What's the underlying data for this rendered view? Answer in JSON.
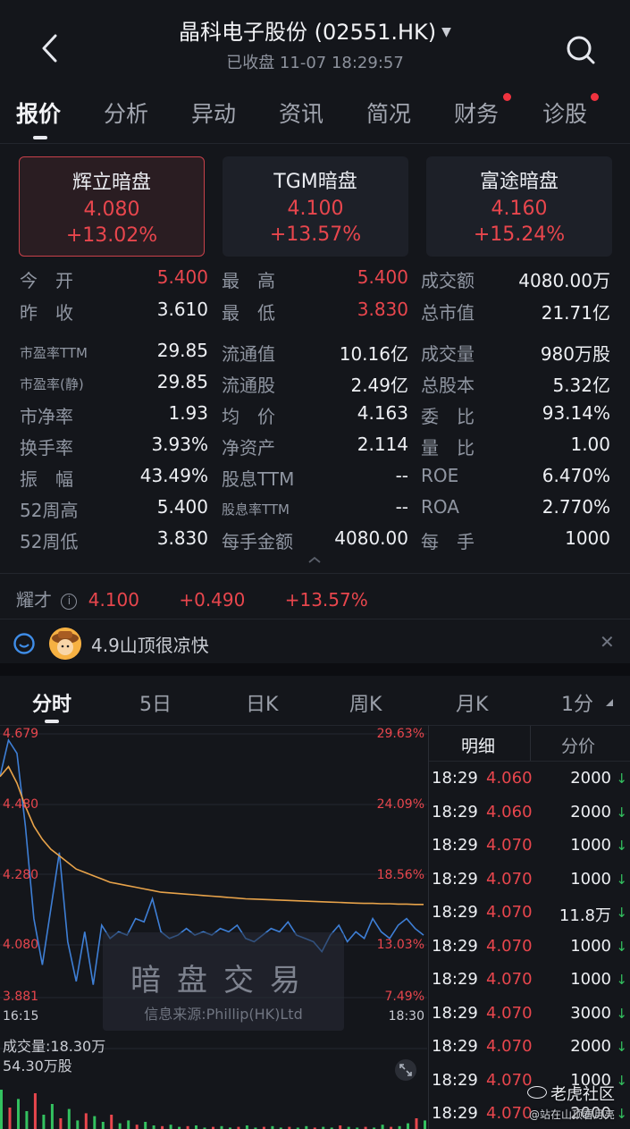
{
  "header": {
    "title": "晶科电子股份 (02551.HK)",
    "status_time": "已收盘 11-07 18:29:57"
  },
  "tabs": [
    {
      "label": "报价",
      "active": true,
      "dot": false
    },
    {
      "label": "分析",
      "active": false,
      "dot": false
    },
    {
      "label": "异动",
      "active": false,
      "dot": false
    },
    {
      "label": "资讯",
      "active": false,
      "dot": false
    },
    {
      "label": "简况",
      "active": false,
      "dot": false
    },
    {
      "label": "财务",
      "active": false,
      "dot": true
    },
    {
      "label": "诊股",
      "active": false,
      "dot": true
    }
  ],
  "dark_pools": [
    {
      "name": "辉立暗盘",
      "price": "4.080",
      "change": "+13.02%",
      "selected": true
    },
    {
      "name": "TGM暗盘",
      "price": "4.100",
      "change": "+13.57%",
      "selected": false
    },
    {
      "name": "富途暗盘",
      "price": "4.160",
      "change": "+15.24%",
      "selected": false
    }
  ],
  "stats": [
    [
      {
        "label": "今　开",
        "value": "5.400",
        "color": "red"
      },
      {
        "label": "最　高",
        "value": "5.400",
        "color": "red"
      },
      {
        "label": "成交额",
        "value": "4080.00万",
        "color": "white"
      }
    ],
    [
      {
        "label": "昨　收",
        "value": "3.610",
        "color": "white"
      },
      {
        "label": "最　低",
        "value": "3.830",
        "color": "red"
      },
      {
        "label": "总市值",
        "value": "21.71亿",
        "color": "white"
      }
    ],
    [
      {
        "label": "市盈率TTM",
        "value": "29.85",
        "color": "white",
        "small": true
      },
      {
        "label": "流通值",
        "value": "10.16亿",
        "color": "white"
      },
      {
        "label": "成交量",
        "value": "980万股",
        "color": "white"
      }
    ],
    [
      {
        "label": "市盈率(静)",
        "value": "29.85",
        "color": "white",
        "small": true
      },
      {
        "label": "流通股",
        "value": "2.49亿",
        "color": "white"
      },
      {
        "label": "总股本",
        "value": "5.32亿",
        "color": "white"
      }
    ],
    [
      {
        "label": "市净率",
        "value": "1.93",
        "color": "white"
      },
      {
        "label": "均　价",
        "value": "4.163",
        "color": "white"
      },
      {
        "label": "委　比",
        "value": "93.14%",
        "color": "white"
      }
    ],
    [
      {
        "label": "换手率",
        "value": "3.93%",
        "color": "white"
      },
      {
        "label": "净资产",
        "value": "2.114",
        "color": "white"
      },
      {
        "label": "量　比",
        "value": "1.00",
        "color": "white"
      }
    ],
    [
      {
        "label": "振　幅",
        "value": "43.49%",
        "color": "white"
      },
      {
        "label": "股息TTM",
        "value": "--",
        "color": "white"
      },
      {
        "label": "ROE",
        "value": "6.470%",
        "color": "white"
      }
    ],
    [
      {
        "label": "52周高",
        "value": "5.400",
        "color": "white"
      },
      {
        "label": "股息率TTM",
        "value": "--",
        "color": "white",
        "small": true
      },
      {
        "label": "ROA",
        "value": "2.770%",
        "color": "white"
      }
    ],
    [
      {
        "label": "52周低",
        "value": "3.830",
        "color": "white"
      },
      {
        "label": "每手金额",
        "value": "4080.00",
        "color": "white"
      },
      {
        "label": "每　手",
        "value": "1000",
        "color": "white"
      }
    ]
  ],
  "after_hours": {
    "label": "耀才",
    "price": "4.100",
    "change": "+0.490",
    "percent": "+13.57%"
  },
  "ticker": {
    "text": "4.9山顶很凉快"
  },
  "chart_tabs": [
    {
      "label": "分时",
      "active": true
    },
    {
      "label": "5日",
      "active": false
    },
    {
      "label": "日K",
      "active": false
    },
    {
      "label": "周K",
      "active": false
    },
    {
      "label": "月K",
      "active": false
    },
    {
      "label": "1分",
      "active": false
    }
  ],
  "chart": {
    "y_left": [
      "4.679",
      "4.480",
      "4.280",
      "4.080",
      "3.881"
    ],
    "y_right": [
      "29.63%",
      "24.09%",
      "18.56%",
      "13.03%",
      "7.49%"
    ],
    "x_start": "16:15",
    "x_end": "18:30",
    "watermark": "暗盘交易",
    "source": "信息来源:Phillip(HK)Ltd",
    "volume_label": "成交量:18.30万",
    "volume_axis_max": "54.30万股",
    "line_color": "#3e7fd6",
    "avg_color": "#e8a34a"
  },
  "chart_data": {
    "type": "line",
    "x_start": "16:15",
    "x_end": "18:30",
    "ylim": [
      3.881,
      4.679
    ],
    "series": [
      {
        "values": [
          4.55,
          4.66,
          4.62,
          4.4,
          4.12,
          3.98,
          4.15,
          4.32,
          4.05,
          3.93,
          4.08,
          3.92,
          4.1,
          4.06,
          4.08,
          4.07,
          4.12,
          4.11,
          4.18,
          4.08,
          4.06,
          4.07,
          4.09,
          4.07,
          4.08,
          4.07,
          4.09,
          4.08,
          4.1,
          4.06,
          4.05,
          4.07,
          4.09,
          4.08,
          4.11,
          4.07,
          4.06,
          4.05,
          4.02,
          4.07,
          4.1,
          4.05,
          4.08,
          4.06,
          4.12,
          4.08,
          4.06,
          4.1,
          4.12,
          4.09,
          4.07
        ]
      },
      {
        "values": [
          4.55,
          4.58,
          4.53,
          4.46,
          4.4,
          4.36,
          4.33,
          4.31,
          4.29,
          4.27,
          4.26,
          4.25,
          4.24,
          4.23,
          4.225,
          4.22,
          4.215,
          4.21,
          4.205,
          4.2,
          4.198,
          4.196,
          4.194,
          4.192,
          4.19,
          4.188,
          4.186,
          4.184,
          4.182,
          4.18,
          4.179,
          4.178,
          4.177,
          4.176,
          4.175,
          4.174,
          4.173,
          4.172,
          4.171,
          4.17,
          4.169,
          4.168,
          4.167,
          4.166,
          4.166,
          4.165,
          4.165,
          4.164,
          4.164,
          4.163,
          4.163
        ]
      }
    ],
    "volume": [
      0.55,
      0.3,
      0.42,
      0.25,
      0.5,
      0.2,
      0.35,
      0.15,
      0.28,
      0.12,
      0.22,
      0.18,
      0.1,
      0.2,
      0.08,
      0.12,
      0.06,
      0.1,
      0.05,
      0.04,
      0.06,
      0.03,
      0.04,
      0.05,
      0.02,
      0.03,
      0.04,
      0.02,
      0.03,
      0.05,
      0.02,
      0.03,
      0.04,
      0.02,
      0.03,
      0.02,
      0.04,
      0.02,
      0.03,
      0.02,
      0.05,
      0.03,
      0.02,
      0.03,
      0.02,
      0.06,
      0.03,
      0.04,
      0.08,
      0.15,
      0.12
    ]
  },
  "trade_list": {
    "tab_detail": "明细",
    "tab_price": "分价",
    "rows": [
      {
        "time": "18:29",
        "price": "4.060",
        "volume": "2000"
      },
      {
        "time": "18:29",
        "price": "4.060",
        "volume": "2000"
      },
      {
        "time": "18:29",
        "price": "4.070",
        "volume": "1000"
      },
      {
        "time": "18:29",
        "price": "4.070",
        "volume": "1000"
      },
      {
        "time": "18:29",
        "price": "4.070",
        "volume": "11.8万"
      },
      {
        "time": "18:29",
        "price": "4.070",
        "volume": "1000"
      },
      {
        "time": "18:29",
        "price": "4.070",
        "volume": "1000"
      },
      {
        "time": "18:29",
        "price": "4.070",
        "volume": "3000"
      },
      {
        "time": "18:29",
        "price": "4.070",
        "volume": "2000"
      },
      {
        "time": "18:29",
        "price": "4.070",
        "volume": "1000"
      },
      {
        "time": "18:29",
        "price": "4.070",
        "volume": "2000"
      }
    ]
  },
  "brand": {
    "name": "老虎社区",
    "caption": "@站在山顶看月亮"
  }
}
